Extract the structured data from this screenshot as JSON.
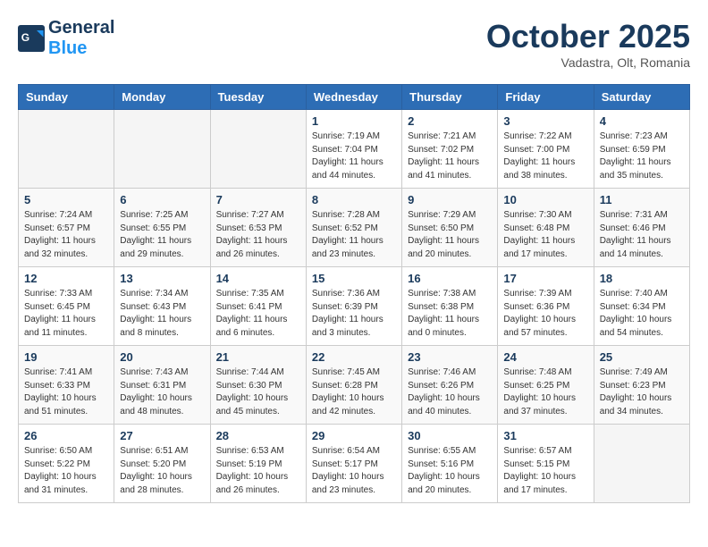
{
  "header": {
    "logo_line1": "General",
    "logo_line2": "Blue",
    "month": "October 2025",
    "location": "Vadastra, Olt, Romania"
  },
  "weekdays": [
    "Sunday",
    "Monday",
    "Tuesday",
    "Wednesday",
    "Thursday",
    "Friday",
    "Saturday"
  ],
  "weeks": [
    [
      {
        "day": "",
        "info": ""
      },
      {
        "day": "",
        "info": ""
      },
      {
        "day": "",
        "info": ""
      },
      {
        "day": "1",
        "info": "Sunrise: 7:19 AM\nSunset: 7:04 PM\nDaylight: 11 hours\nand 44 minutes."
      },
      {
        "day": "2",
        "info": "Sunrise: 7:21 AM\nSunset: 7:02 PM\nDaylight: 11 hours\nand 41 minutes."
      },
      {
        "day": "3",
        "info": "Sunrise: 7:22 AM\nSunset: 7:00 PM\nDaylight: 11 hours\nand 38 minutes."
      },
      {
        "day": "4",
        "info": "Sunrise: 7:23 AM\nSunset: 6:59 PM\nDaylight: 11 hours\nand 35 minutes."
      }
    ],
    [
      {
        "day": "5",
        "info": "Sunrise: 7:24 AM\nSunset: 6:57 PM\nDaylight: 11 hours\nand 32 minutes."
      },
      {
        "day": "6",
        "info": "Sunrise: 7:25 AM\nSunset: 6:55 PM\nDaylight: 11 hours\nand 29 minutes."
      },
      {
        "day": "7",
        "info": "Sunrise: 7:27 AM\nSunset: 6:53 PM\nDaylight: 11 hours\nand 26 minutes."
      },
      {
        "day": "8",
        "info": "Sunrise: 7:28 AM\nSunset: 6:52 PM\nDaylight: 11 hours\nand 23 minutes."
      },
      {
        "day": "9",
        "info": "Sunrise: 7:29 AM\nSunset: 6:50 PM\nDaylight: 11 hours\nand 20 minutes."
      },
      {
        "day": "10",
        "info": "Sunrise: 7:30 AM\nSunset: 6:48 PM\nDaylight: 11 hours\nand 17 minutes."
      },
      {
        "day": "11",
        "info": "Sunrise: 7:31 AM\nSunset: 6:46 PM\nDaylight: 11 hours\nand 14 minutes."
      }
    ],
    [
      {
        "day": "12",
        "info": "Sunrise: 7:33 AM\nSunset: 6:45 PM\nDaylight: 11 hours\nand 11 minutes."
      },
      {
        "day": "13",
        "info": "Sunrise: 7:34 AM\nSunset: 6:43 PM\nDaylight: 11 hours\nand 8 minutes."
      },
      {
        "day": "14",
        "info": "Sunrise: 7:35 AM\nSunset: 6:41 PM\nDaylight: 11 hours\nand 6 minutes."
      },
      {
        "day": "15",
        "info": "Sunrise: 7:36 AM\nSunset: 6:39 PM\nDaylight: 11 hours\nand 3 minutes."
      },
      {
        "day": "16",
        "info": "Sunrise: 7:38 AM\nSunset: 6:38 PM\nDaylight: 11 hours\nand 0 minutes."
      },
      {
        "day": "17",
        "info": "Sunrise: 7:39 AM\nSunset: 6:36 PM\nDaylight: 10 hours\nand 57 minutes."
      },
      {
        "day": "18",
        "info": "Sunrise: 7:40 AM\nSunset: 6:34 PM\nDaylight: 10 hours\nand 54 minutes."
      }
    ],
    [
      {
        "day": "19",
        "info": "Sunrise: 7:41 AM\nSunset: 6:33 PM\nDaylight: 10 hours\nand 51 minutes."
      },
      {
        "day": "20",
        "info": "Sunrise: 7:43 AM\nSunset: 6:31 PM\nDaylight: 10 hours\nand 48 minutes."
      },
      {
        "day": "21",
        "info": "Sunrise: 7:44 AM\nSunset: 6:30 PM\nDaylight: 10 hours\nand 45 minutes."
      },
      {
        "day": "22",
        "info": "Sunrise: 7:45 AM\nSunset: 6:28 PM\nDaylight: 10 hours\nand 42 minutes."
      },
      {
        "day": "23",
        "info": "Sunrise: 7:46 AM\nSunset: 6:26 PM\nDaylight: 10 hours\nand 40 minutes."
      },
      {
        "day": "24",
        "info": "Sunrise: 7:48 AM\nSunset: 6:25 PM\nDaylight: 10 hours\nand 37 minutes."
      },
      {
        "day": "25",
        "info": "Sunrise: 7:49 AM\nSunset: 6:23 PM\nDaylight: 10 hours\nand 34 minutes."
      }
    ],
    [
      {
        "day": "26",
        "info": "Sunrise: 6:50 AM\nSunset: 5:22 PM\nDaylight: 10 hours\nand 31 minutes."
      },
      {
        "day": "27",
        "info": "Sunrise: 6:51 AM\nSunset: 5:20 PM\nDaylight: 10 hours\nand 28 minutes."
      },
      {
        "day": "28",
        "info": "Sunrise: 6:53 AM\nSunset: 5:19 PM\nDaylight: 10 hours\nand 26 minutes."
      },
      {
        "day": "29",
        "info": "Sunrise: 6:54 AM\nSunset: 5:17 PM\nDaylight: 10 hours\nand 23 minutes."
      },
      {
        "day": "30",
        "info": "Sunrise: 6:55 AM\nSunset: 5:16 PM\nDaylight: 10 hours\nand 20 minutes."
      },
      {
        "day": "31",
        "info": "Sunrise: 6:57 AM\nSunset: 5:15 PM\nDaylight: 10 hours\nand 17 minutes."
      },
      {
        "day": "",
        "info": ""
      }
    ]
  ]
}
